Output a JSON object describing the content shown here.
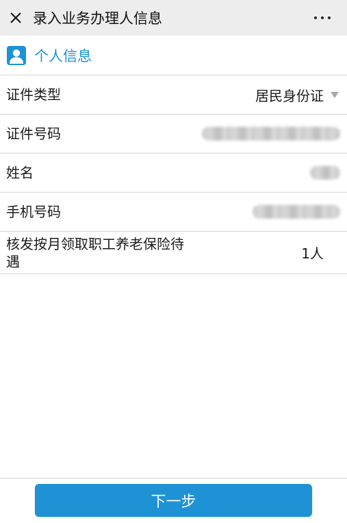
{
  "titlebar": {
    "title": "录入业务办理人信息",
    "close_icon": "close-icon",
    "more_icon": "more-dots-icon"
  },
  "section": {
    "title": "个人信息",
    "icon": "user-icon",
    "accent_color": "#1e92d4"
  },
  "form": {
    "id_type": {
      "label": "证件类型",
      "value": "居民身份证"
    },
    "id_number": {
      "label": "证件号码"
    },
    "name": {
      "label": "姓名"
    },
    "phone": {
      "label": "手机号码"
    },
    "pension": {
      "label": "核发按月领取职工养老保险待遇",
      "value": "1人"
    }
  },
  "footer": {
    "next_label": "下一步"
  }
}
